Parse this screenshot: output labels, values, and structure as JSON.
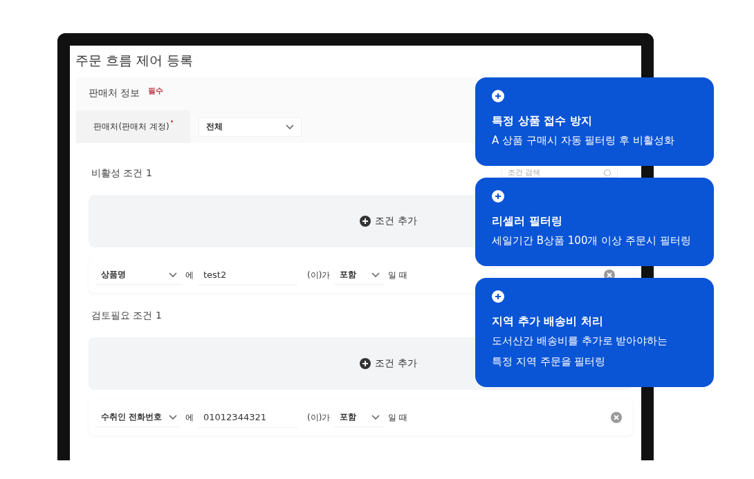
{
  "page_title": "주문 흐름 제어 등록",
  "seller_section": {
    "title": "판매처 정보",
    "required_badge": "필수",
    "field_label": "판매처(판매처 계정)",
    "required": true,
    "select_value": "전체"
  },
  "search": {
    "placeholder": "조건 검색"
  },
  "condition_groups": [
    {
      "title": "비활성 조건",
      "count": "1",
      "add_button": "조건 추가",
      "rule": {
        "field": "상품명",
        "particle": "에",
        "value": "test2",
        "operator_label": "(이)가",
        "operator": "포함",
        "suffix": "일 때"
      }
    },
    {
      "title": "검토필요 조건",
      "count": "1",
      "add_button": "조건 추가",
      "rule": {
        "field": "수취인 전화번호",
        "particle": "에",
        "value": "01012344321",
        "operator_label": "(이)가",
        "operator": "포함",
        "suffix": "일 때"
      }
    }
  ],
  "feature_cards": [
    {
      "title": "특정 상품 접수 방지",
      "description": [
        "A 상품 구매시 자동 필터링 후 비활성화"
      ]
    },
    {
      "title": "리셀러 필터링",
      "description": [
        "세일기간 B상품 100개 이상 주문시 필터링"
      ]
    },
    {
      "title": "지역 추가 배송비 처리",
      "description": [
        "도서산간 배송비를 추가로 받아야하는",
        "특정 지역 주문을 필터링"
      ]
    }
  ]
}
